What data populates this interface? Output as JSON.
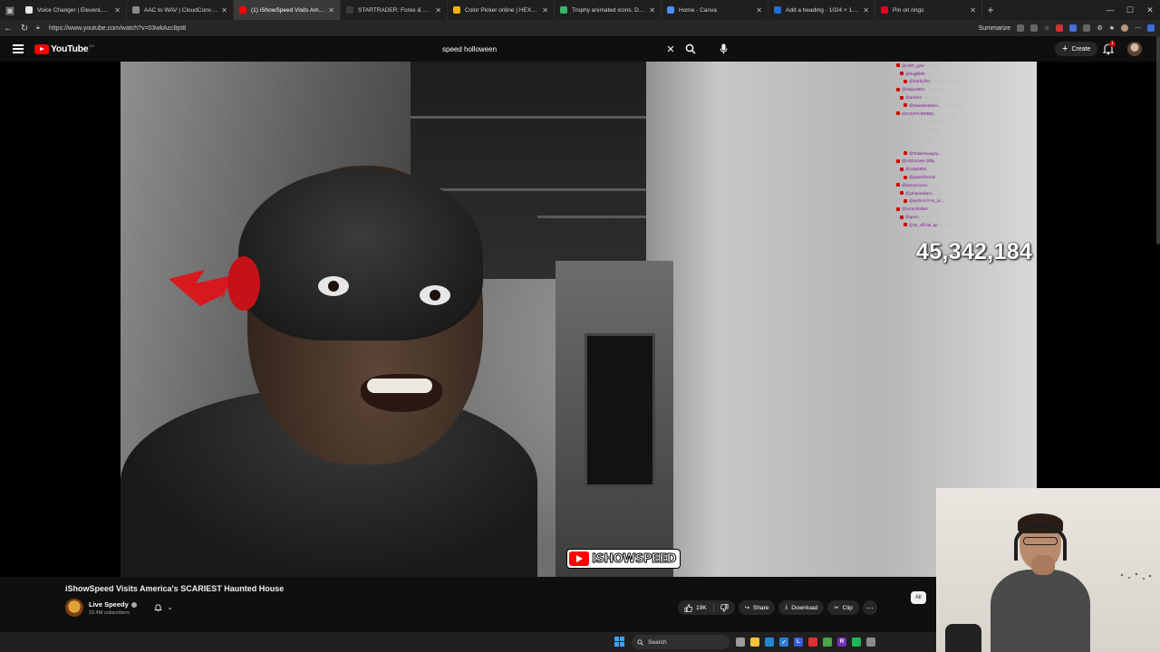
{
  "browser": {
    "tabs": [
      {
        "title": "Voice Changer | ElevenLabs",
        "color": "#e8e8e8",
        "active": false
      },
      {
        "title": "AAC to WAV | CloudConvert",
        "color": "#8a8a8a",
        "active": false
      },
      {
        "title": "(1) iShowSpeed Visits Ameri",
        "color": "#ff0000",
        "active": true
      },
      {
        "title": "STARTRADER: Forex & CFD Tradi",
        "color": "#3a3a3a",
        "active": false
      },
      {
        "title": "Color Picker online | HEX Colo",
        "color": "#f5b400",
        "active": false
      },
      {
        "title": "Trophy animated icons. Downlo",
        "color": "#3bb46e",
        "active": false
      },
      {
        "title": "Home - Canva",
        "color": "#4f8df5",
        "active": false
      },
      {
        "title": "Add a heading - 1024 × 1024px",
        "color": "#1f6fd6",
        "active": false
      },
      {
        "title": "Pin on rings",
        "color": "#e60023",
        "active": false
      }
    ],
    "url": "https://www.youtube.com/watch?v=03wkAzc8pt8",
    "summarize_label": "Summarize"
  },
  "youtube": {
    "logo_text": "YouTube",
    "country_code": "CH",
    "search": {
      "value": "speed holloween",
      "placeholder": "Search"
    },
    "create_label": "Create",
    "notification_count": "1"
  },
  "video": {
    "live_counter": "45,342,184",
    "watermark": "ISHOWSPEED",
    "title": "iShowSpeed Visits America's SCARIEST Haunted House",
    "chat_lines": [
      {
        "name": "@ARP_g2w",
        "msg": "··· ··· ···"
      },
      {
        "name": "@bugfill99",
        "msg": "··· ···"
      },
      {
        "name": "@Darbyfilm",
        "msg": "·· ·· ·· ·· ··· ···"
      },
      {
        "name": "@kalpu2951",
        "msg": "···· ··· ···"
      },
      {
        "name": "@artic51",
        "msg": "··· ·· ····"
      },
      {
        "name": "@travelanddum...",
        "msg": "·· ·· ·· ··· ··"
      },
      {
        "name": "SOULRYHREBEL",
        "msg": "·· ···· ·· ···"
      },
      {
        "name": "",
        "msg": "··· ··· ··· ··"
      },
      {
        "name": "",
        "msg": "··· ·· ···"
      },
      {
        "name": "",
        "msg": "··· ··"
      },
      {
        "name": "",
        "msg": ""
      },
      {
        "name": "@Trailerswagzy...",
        "msg": "·· ··"
      },
      {
        "name": "@ADDJeww @lily",
        "msg": "·· ·"
      },
      {
        "name": "@cutp5893",
        "msg": "·· ··"
      },
      {
        "name": "@pawnfriend2",
        "msg": "··· ··"
      },
      {
        "name": "@harrymoon1",
        "msg": "··· ···"
      },
      {
        "name": "@johannakam...",
        "msg": "·· ·"
      },
      {
        "name": "@python.FAN_yo...",
        "msg": "·· ··"
      },
      {
        "name": "@sommhalker",
        "msg": "··· ·"
      },
      {
        "name": "@geno",
        "msg": "·· ·· ··"
      },
      {
        "name": "@its_official_ap",
        "msg": "·· ·· ···"
      }
    ]
  },
  "channel": {
    "name": "Live Speedy",
    "subscribers": "15.4M subscribers"
  },
  "actions": {
    "likes": "19K",
    "share": "Share",
    "download": "Download",
    "clip": "Clip"
  },
  "filter_chip": "All",
  "taskbar": {
    "search_label": "Search",
    "apps": [
      {
        "name": "task-view",
        "color": "#9a9a9a",
        "glyph": ""
      },
      {
        "name": "file-explorer",
        "color": "#f3c33b",
        "glyph": ""
      },
      {
        "name": "edge",
        "color": "#1f8ad6",
        "glyph": ""
      },
      {
        "name": "vscode-like",
        "color": "#2a7fd4",
        "glyph": "✓"
      },
      {
        "name": "app-l",
        "color": "#3b5bdb",
        "glyph": "L"
      },
      {
        "name": "app-flag",
        "color": "#e03131",
        "glyph": ""
      },
      {
        "name": "chrome",
        "color": "#4aa54a",
        "glyph": ""
      },
      {
        "name": "app-r",
        "color": "#7b2cbf",
        "glyph": "R"
      },
      {
        "name": "spotify",
        "color": "#1db954",
        "glyph": ""
      },
      {
        "name": "app-doc",
        "color": "#8a8a8a",
        "glyph": ""
      }
    ]
  }
}
